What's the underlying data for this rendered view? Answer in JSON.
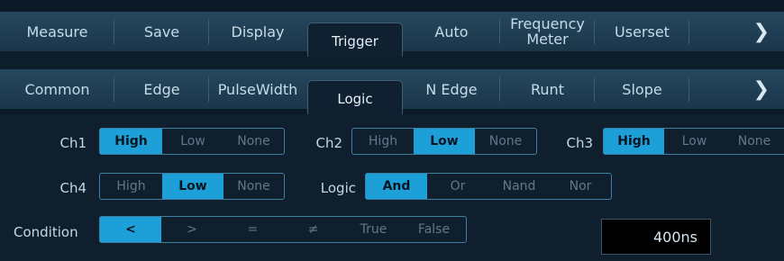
{
  "top_tabs": [
    {
      "label": "Measure",
      "active": false
    },
    {
      "label": "Save",
      "active": false
    },
    {
      "label": "Display",
      "active": false
    },
    {
      "label": "Trigger",
      "active": true
    },
    {
      "label": "Auto",
      "active": false
    },
    {
      "label": "Frequency\nMeter",
      "active": false
    },
    {
      "label": "Userset",
      "active": false
    },
    {
      "label": "❯",
      "active": false
    }
  ],
  "sub_tabs": [
    {
      "label": "Common",
      "active": false
    },
    {
      "label": "Edge",
      "active": false
    },
    {
      "label": "PulseWidth",
      "active": false
    },
    {
      "label": "Logic",
      "active": true
    },
    {
      "label": "N Edge",
      "active": false
    },
    {
      "label": "Runt",
      "active": false
    },
    {
      "label": "Slope",
      "active": false
    },
    {
      "label": "❯",
      "active": false
    }
  ],
  "channels": {
    "ch1": {
      "label": "Ch1",
      "options": [
        "High",
        "Low",
        "None"
      ],
      "selected": "High"
    },
    "ch2": {
      "label": "Ch2",
      "options": [
        "High",
        "Low",
        "None"
      ],
      "selected": "Low"
    },
    "ch3": {
      "label": "Ch3",
      "options": [
        "High",
        "Low",
        "None"
      ],
      "selected": "High"
    },
    "ch4": {
      "label": "Ch4",
      "options": [
        "High",
        "Low",
        "None"
      ],
      "selected": "Low"
    }
  },
  "logic": {
    "label": "Logic",
    "options": [
      "And",
      "Or",
      "Nand",
      "Nor"
    ],
    "selected": "And"
  },
  "condition": {
    "label": "Condition",
    "options": [
      "<",
      ">",
      "=",
      "≠",
      "True",
      "False"
    ],
    "selected": "<"
  },
  "time_value": "400ns",
  "colors": {
    "selected": "#1d9fd8",
    "border": "#3f7fa1",
    "background": "#0f1f2d"
  }
}
